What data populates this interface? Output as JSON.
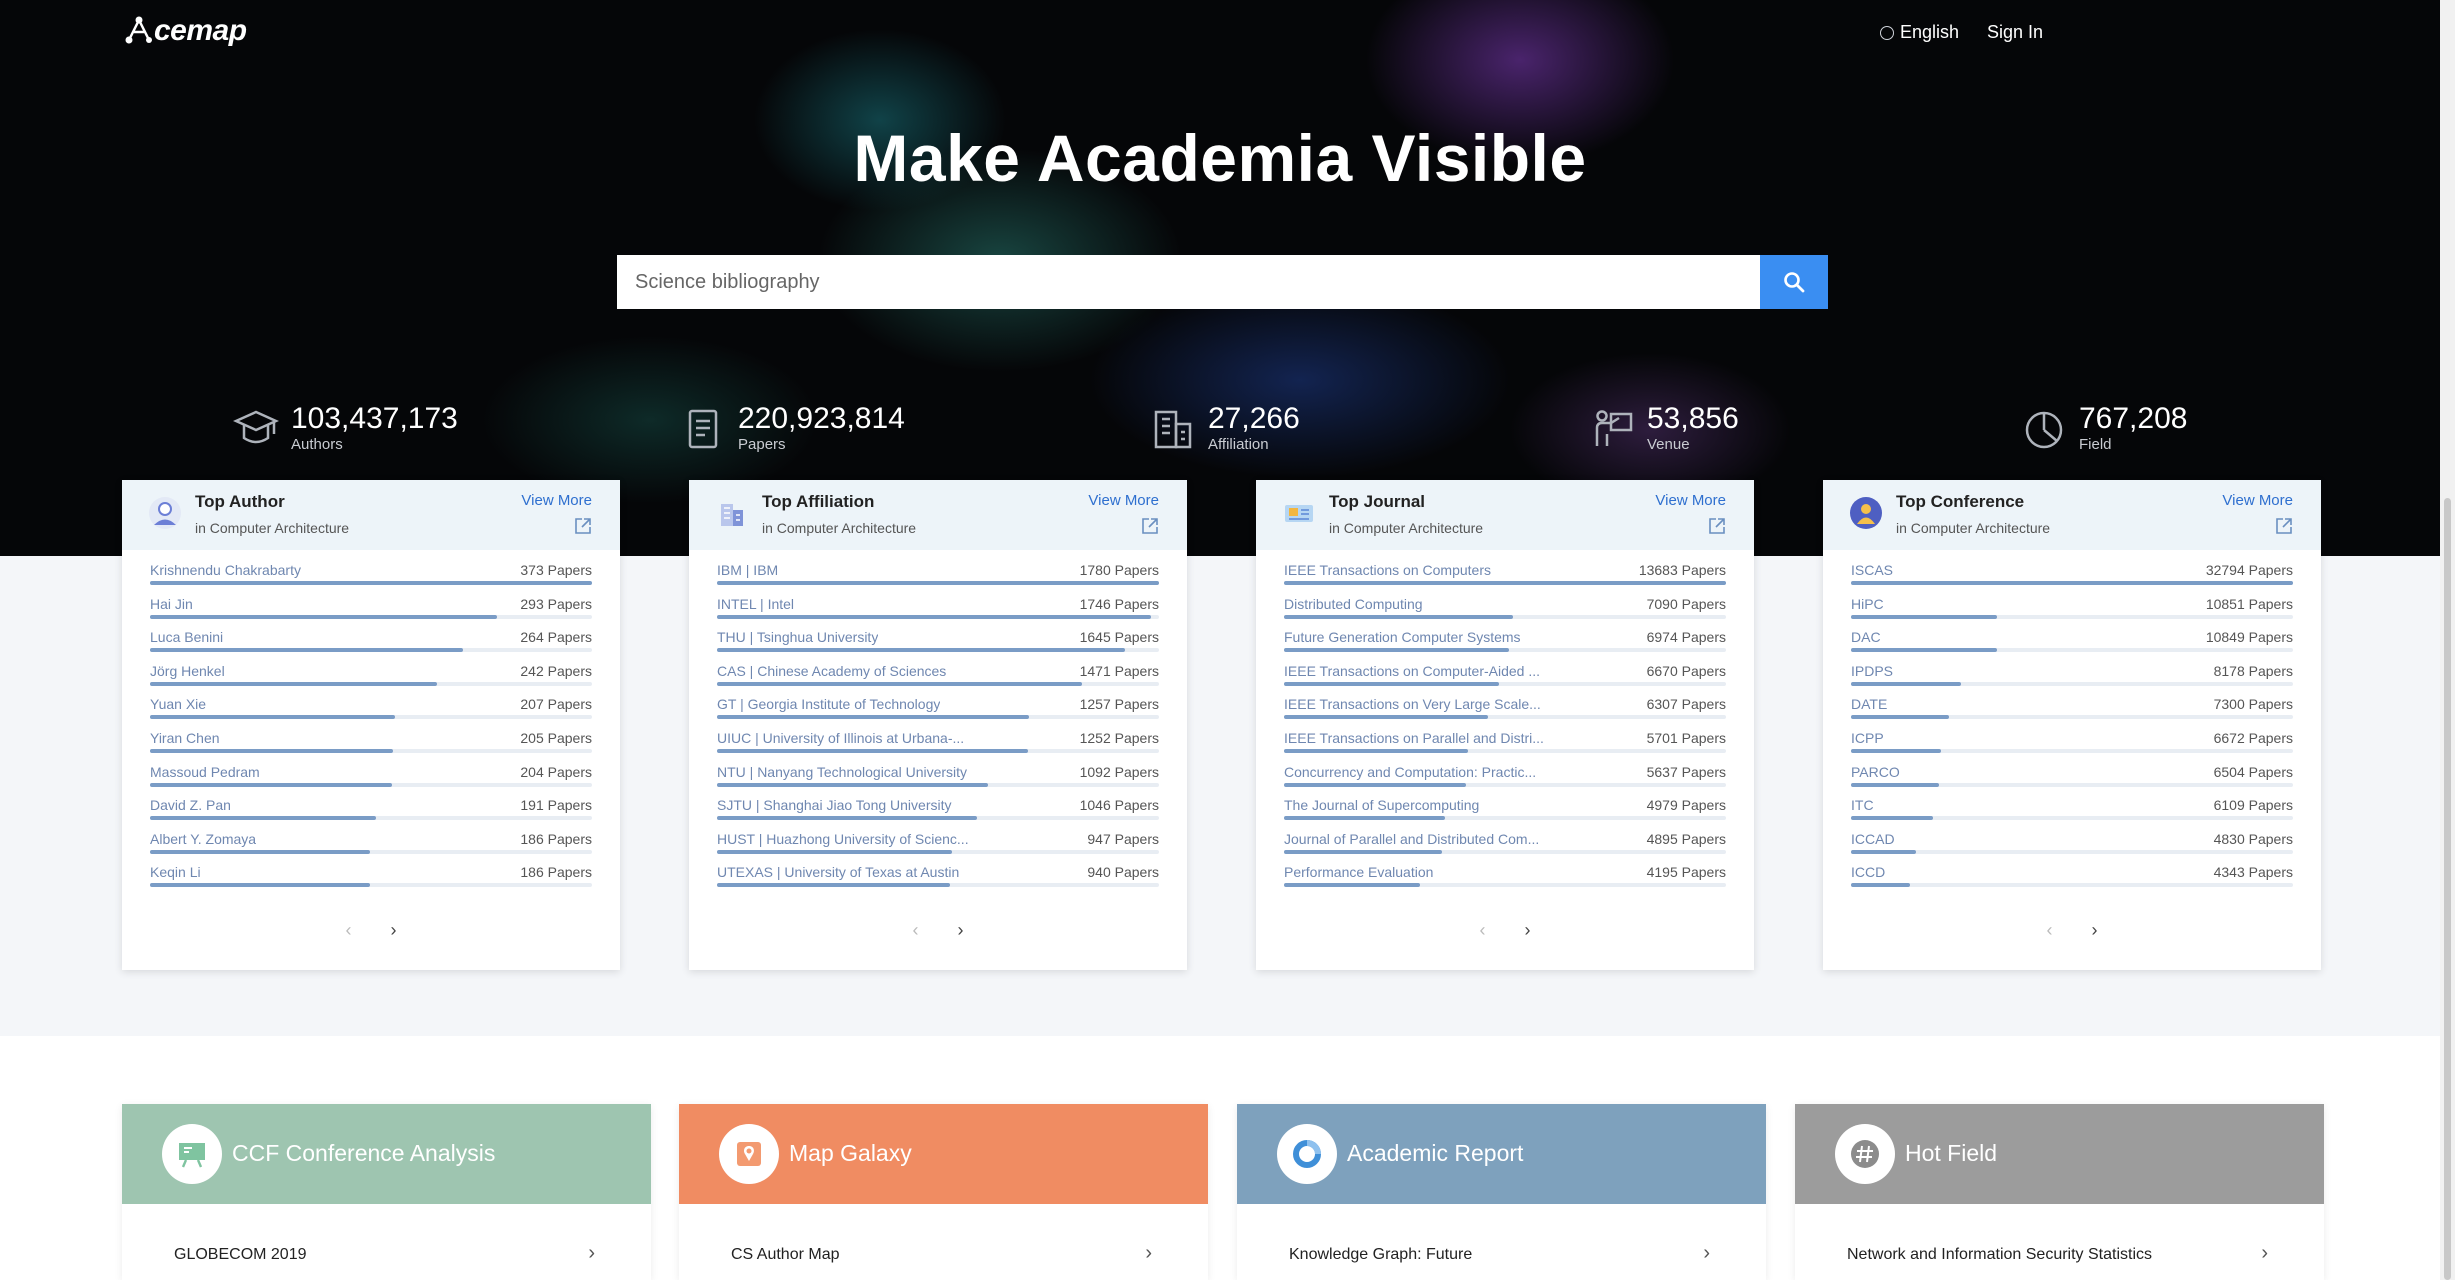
{
  "nav": {
    "logo_text": "cemap",
    "language": "English",
    "sign_in": "Sign In"
  },
  "hero": {
    "headline": "Make Academia Visible",
    "search_placeholder": "Science bibliography"
  },
  "stats": [
    {
      "value": "103,437,173",
      "label": "Authors",
      "icon": "graduation-cap-icon"
    },
    {
      "value": "220,923,814",
      "label": "Papers",
      "icon": "document-icon"
    },
    {
      "value": "27,266",
      "label": "Affiliation",
      "icon": "building-icon"
    },
    {
      "value": "53,856",
      "label": "Venue",
      "icon": "venue-icon"
    },
    {
      "value": "767,208",
      "label": "Field",
      "icon": "pie-icon"
    }
  ],
  "cards": [
    {
      "title": "Top Author",
      "subtitle": "in Computer Architecture",
      "view_more": "View More",
      "max": 373,
      "items": [
        {
          "name": "Krishnendu Chakrabarty",
          "count": 373,
          "label": "373 Papers"
        },
        {
          "name": "Hai Jin",
          "count": 293,
          "label": "293 Papers"
        },
        {
          "name": "Luca Benini",
          "count": 264,
          "label": "264 Papers"
        },
        {
          "name": "Jörg Henkel",
          "count": 242,
          "label": "242 Papers"
        },
        {
          "name": "Yuan Xie",
          "count": 207,
          "label": "207 Papers"
        },
        {
          "name": "Yiran Chen",
          "count": 205,
          "label": "205 Papers"
        },
        {
          "name": "Massoud Pedram",
          "count": 204,
          "label": "204 Papers"
        },
        {
          "name": "David Z. Pan",
          "count": 191,
          "label": "191 Papers"
        },
        {
          "name": "Albert Y. Zomaya",
          "count": 186,
          "label": "186 Papers"
        },
        {
          "name": "Keqin Li",
          "count": 186,
          "label": "186 Papers"
        }
      ]
    },
    {
      "title": "Top Affiliation",
      "subtitle": "in Computer Architecture",
      "view_more": "View More",
      "max": 1780,
      "items": [
        {
          "name": "IBM | IBM",
          "count": 1780,
          "label": "1780 Papers"
        },
        {
          "name": "INTEL | Intel",
          "count": 1746,
          "label": "1746 Papers"
        },
        {
          "name": "THU | Tsinghua University",
          "count": 1645,
          "label": "1645 Papers"
        },
        {
          "name": "CAS | Chinese Academy of Sciences",
          "count": 1471,
          "label": "1471 Papers"
        },
        {
          "name": "GT | Georgia Institute of Technology",
          "count": 1257,
          "label": "1257 Papers"
        },
        {
          "name": "UIUC | University of Illinois at Urbana-...",
          "count": 1252,
          "label": "1252 Papers"
        },
        {
          "name": "NTU | Nanyang Technological University",
          "count": 1092,
          "label": "1092 Papers"
        },
        {
          "name": "SJTU | Shanghai Jiao Tong University",
          "count": 1046,
          "label": "1046 Papers"
        },
        {
          "name": "HUST | Huazhong University of Scienc...",
          "count": 947,
          "label": "947 Papers"
        },
        {
          "name": "UTEXAS | University of Texas at Austin",
          "count": 940,
          "label": "940 Papers"
        }
      ]
    },
    {
      "title": "Top Journal",
      "subtitle": "in Computer Architecture",
      "view_more": "View More",
      "max": 13683,
      "items": [
        {
          "name": "IEEE Transactions on Computers",
          "count": 13683,
          "label": "13683 Papers"
        },
        {
          "name": "Distributed Computing",
          "count": 7090,
          "label": "7090 Papers"
        },
        {
          "name": "Future Generation Computer Systems",
          "count": 6974,
          "label": "6974 Papers"
        },
        {
          "name": "IEEE Transactions on Computer-Aided ...",
          "count": 6670,
          "label": "6670 Papers"
        },
        {
          "name": "IEEE Transactions on Very Large Scale...",
          "count": 6307,
          "label": "6307 Papers"
        },
        {
          "name": "IEEE Transactions on Parallel and Distri...",
          "count": 5701,
          "label": "5701 Papers"
        },
        {
          "name": "Concurrency and Computation: Practic...",
          "count": 5637,
          "label": "5637 Papers"
        },
        {
          "name": "The Journal of Supercomputing",
          "count": 4979,
          "label": "4979 Papers"
        },
        {
          "name": "Journal of Parallel and Distributed Com...",
          "count": 4895,
          "label": "4895 Papers"
        },
        {
          "name": "Performance Evaluation",
          "count": 4195,
          "label": "4195 Papers"
        }
      ]
    },
    {
      "title": "Top Conference",
      "subtitle": "in Computer Architecture",
      "view_more": "View More",
      "max": 32794,
      "items": [
        {
          "name": "ISCAS",
          "count": 32794,
          "label": "32794 Papers"
        },
        {
          "name": "HiPC",
          "count": 10851,
          "label": "10851 Papers"
        },
        {
          "name": "DAC",
          "count": 10849,
          "label": "10849 Papers"
        },
        {
          "name": "IPDPS",
          "count": 8178,
          "label": "8178 Papers"
        },
        {
          "name": "DATE",
          "count": 7300,
          "label": "7300 Papers"
        },
        {
          "name": "ICPP",
          "count": 6672,
          "label": "6672 Papers"
        },
        {
          "name": "PARCO",
          "count": 6504,
          "label": "6504 Papers"
        },
        {
          "name": "ITC",
          "count": 6109,
          "label": "6109 Papers"
        },
        {
          "name": "ICCAD",
          "count": 4830,
          "label": "4830 Papers"
        },
        {
          "name": "ICCD",
          "count": 4343,
          "label": "4343 Papers"
        }
      ]
    }
  ],
  "pager": {
    "prev": "‹",
    "next": "›"
  },
  "features": [
    {
      "title": "CCF Conference Analysis",
      "link": "GLOBECOM 2019",
      "color": "#9ec5b0",
      "icon": "presentation-board-icon"
    },
    {
      "title": "Map Galaxy",
      "link": "CS Author Map",
      "color": "#f08c62",
      "icon": "map-pin-icon"
    },
    {
      "title": "Academic Report",
      "link": "Knowledge Graph: Future",
      "color": "#7ea1bd",
      "icon": "donut-chart-icon"
    },
    {
      "title": "Hot Field",
      "link": "Network and Information Security Statistics",
      "color": "#9c9c9c",
      "icon": "hashtag-icon"
    }
  ],
  "colors": {
    "accent": "#3a8ef2",
    "link": "#2e6fcf",
    "bar": "#7a9cc6"
  }
}
